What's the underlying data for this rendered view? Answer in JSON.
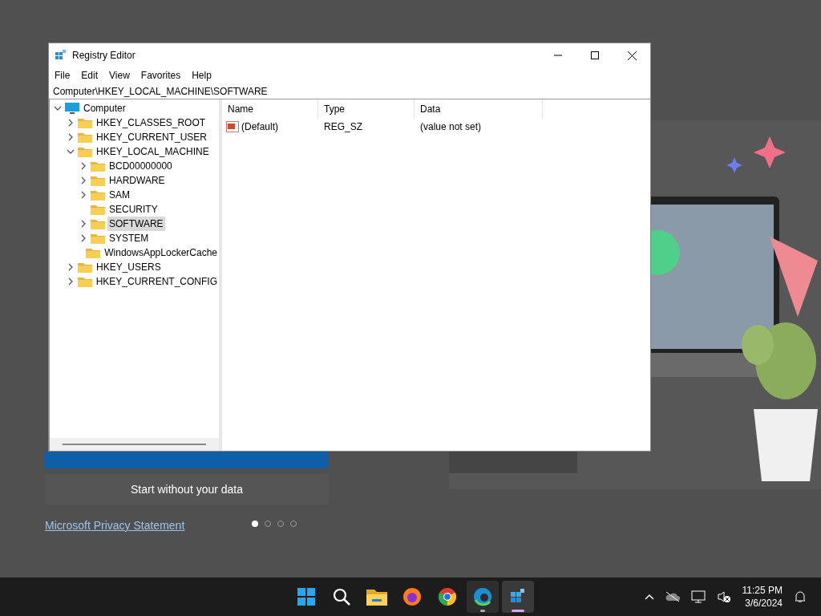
{
  "background": {
    "secondary_button": "Start without your data",
    "privacy_link": "Microsoft Privacy Statement",
    "pager": [
      {
        "selected": true
      },
      {
        "selected": false
      },
      {
        "selected": false
      },
      {
        "selected": false
      }
    ]
  },
  "window": {
    "title": "Registry Editor",
    "menu": [
      "File",
      "Edit",
      "View",
      "Favorites",
      "Help"
    ],
    "address": "Computer\\HKEY_LOCAL_MACHINE\\SOFTWARE",
    "tree": [
      {
        "label": "Computer",
        "kind": "computer",
        "expanded": true,
        "selected": false,
        "children": [
          {
            "label": "HKEY_CLASSES_ROOT",
            "kind": "folder",
            "expanded": false,
            "has_subkeys": true,
            "selected": false
          },
          {
            "label": "HKEY_CURRENT_USER",
            "kind": "folder",
            "expanded": false,
            "has_subkeys": true,
            "selected": false
          },
          {
            "label": "HKEY_LOCAL_MACHINE",
            "kind": "folder",
            "expanded": true,
            "has_subkeys": true,
            "selected": false,
            "children": [
              {
                "label": "BCD00000000",
                "kind": "folder",
                "expanded": false,
                "has_subkeys": true,
                "selected": false
              },
              {
                "label": "HARDWARE",
                "kind": "folder",
                "expanded": false,
                "has_subkeys": true,
                "selected": false
              },
              {
                "label": "SAM",
                "kind": "folder",
                "expanded": false,
                "has_subkeys": true,
                "selected": false
              },
              {
                "label": "SECURITY",
                "kind": "folder",
                "expanded": false,
                "has_subkeys": false,
                "selected": false
              },
              {
                "label": "SOFTWARE",
                "kind": "folder",
                "expanded": false,
                "has_subkeys": true,
                "selected": true
              },
              {
                "label": "SYSTEM",
                "kind": "folder",
                "expanded": false,
                "has_subkeys": true,
                "selected": false
              },
              {
                "label": "WindowsAppLockerCache",
                "kind": "folder",
                "expanded": false,
                "has_subkeys": false,
                "selected": false
              }
            ]
          },
          {
            "label": "HKEY_USERS",
            "kind": "folder",
            "expanded": false,
            "has_subkeys": true,
            "selected": false
          },
          {
            "label": "HKEY_CURRENT_CONFIG",
            "kind": "folder",
            "expanded": false,
            "has_subkeys": true,
            "selected": false
          }
        ]
      }
    ],
    "columns": [
      "Name",
      "Type",
      "Data"
    ],
    "rows": [
      {
        "name": "(Default)",
        "type": "REG_SZ",
        "data": "(value not set)"
      }
    ]
  },
  "taskbar": {
    "apps": [
      {
        "kind": "start",
        "running": false,
        "selected": false
      },
      {
        "kind": "search",
        "running": false,
        "selected": false
      },
      {
        "kind": "explorer",
        "running": false,
        "selected": false
      },
      {
        "kind": "firefox",
        "running": false,
        "selected": false
      },
      {
        "kind": "chrome",
        "running": false,
        "selected": false
      },
      {
        "kind": "edge",
        "running": true,
        "selected": false
      },
      {
        "kind": "regedit",
        "running": true,
        "selected": true
      }
    ],
    "time": "11:25 PM",
    "date": "3/6/2024"
  }
}
